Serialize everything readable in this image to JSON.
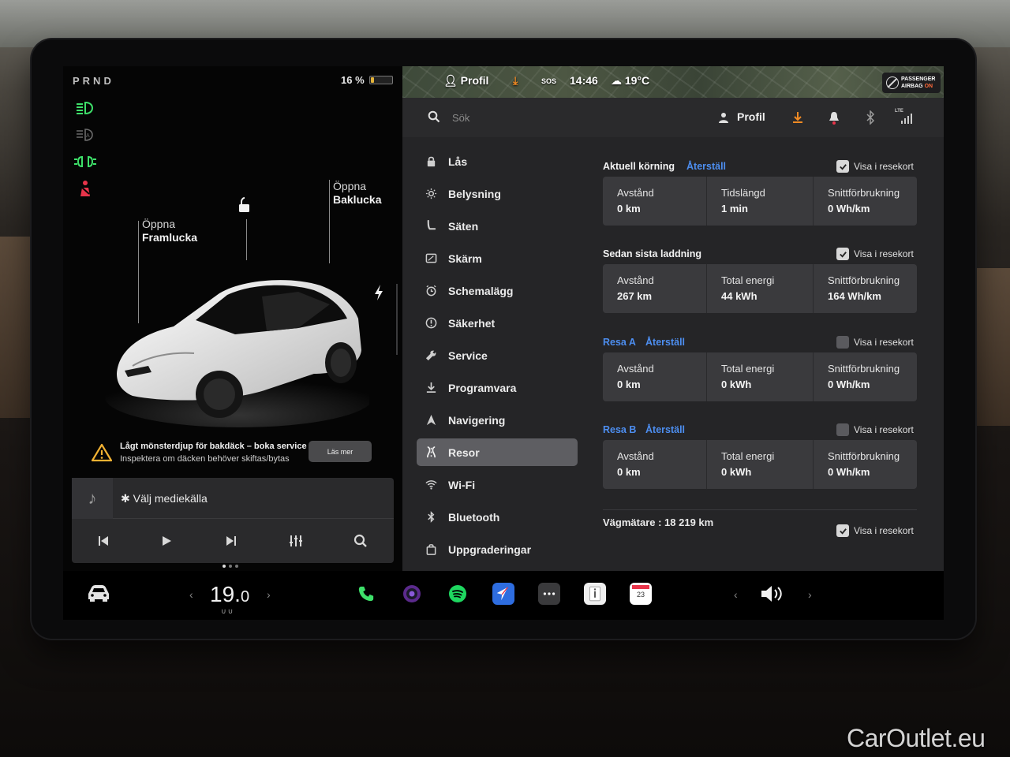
{
  "left_panel": {
    "gear": "PRND",
    "battery_text": "16 %",
    "battery_level": 0.16,
    "frunk_label": {
      "line1": "Öppna",
      "line2": "Framlucka"
    },
    "trunk_label": {
      "line1": "Öppna",
      "line2": "Baklucka"
    },
    "alert": {
      "title": "Lågt mönsterdjup för bakdäck – boka service",
      "subtitle": "Inspektera om däcken behöver skiftas/bytas",
      "button": "Läs mer"
    },
    "media": {
      "source": "✱ Välj mediekälla"
    }
  },
  "status_bar": {
    "profile": "Profil",
    "sos": "SOS",
    "time": "14:46",
    "temperature": "19°C",
    "airbag_line1": "PASSENGER",
    "airbag_line2": "AIRBAG",
    "airbag_state": "ON"
  },
  "topbar": {
    "search_placeholder": "Sök",
    "profile_label": "Profil",
    "lte": "LTE"
  },
  "nav": {
    "items": [
      {
        "label": "Lås",
        "icon": "lock-icon"
      },
      {
        "label": "Belysning",
        "icon": "sun-icon"
      },
      {
        "label": "Säten",
        "icon": "seat-icon"
      },
      {
        "label": "Skärm",
        "icon": "screen-icon"
      },
      {
        "label": "Schemalägg",
        "icon": "alarm-clock-icon"
      },
      {
        "label": "Säkerhet",
        "icon": "alert-circle-icon"
      },
      {
        "label": "Service",
        "icon": "wrench-icon"
      },
      {
        "label": "Programvara",
        "icon": "download-icon"
      },
      {
        "label": "Navigering",
        "icon": "navigation-arrow-icon"
      },
      {
        "label": "Resor",
        "icon": "trips-icon",
        "active": true
      },
      {
        "label": "Wi-Fi",
        "icon": "wifi-icon"
      },
      {
        "label": "Bluetooth",
        "icon": "bluetooth-icon"
      },
      {
        "label": "Uppgraderingar",
        "icon": "shopping-bag-icon"
      }
    ]
  },
  "trips": {
    "show_label": "Visa i resekort",
    "reset_label": "Återställ",
    "current": {
      "title": "Aktuell körning",
      "show_checked": true,
      "stats": [
        {
          "label": "Avstånd",
          "value": "0 km"
        },
        {
          "label": "Tidslängd",
          "value": "1 min"
        },
        {
          "label": "Snittförbrukning",
          "value": "0 Wh/km"
        }
      ]
    },
    "since_charge": {
      "title": "Sedan sista laddning",
      "show_checked": true,
      "stats": [
        {
          "label": "Avstånd",
          "value": "267 km"
        },
        {
          "label": "Total energi",
          "value": "44 kWh"
        },
        {
          "label": "Snittförbrukning",
          "value": "164 Wh/km"
        }
      ]
    },
    "trip_a": {
      "title": "Resa A",
      "show_checked": false,
      "stats": [
        {
          "label": "Avstånd",
          "value": "0 km"
        },
        {
          "label": "Total energi",
          "value": "0 kWh"
        },
        {
          "label": "Snittförbrukning",
          "value": "0 Wh/km"
        }
      ]
    },
    "trip_b": {
      "title": "Resa B",
      "show_checked": false,
      "stats": [
        {
          "label": "Avstånd",
          "value": "0 km"
        },
        {
          "label": "Total energi",
          "value": "0 kWh"
        },
        {
          "label": "Snittförbrukning",
          "value": "0 Wh/km"
        }
      ]
    },
    "odometer": "Vägmätare :  18 219 km",
    "odometer_checked": true
  },
  "dock": {
    "temp_main": "19.",
    "temp_decimal": "0",
    "prev": "‹",
    "next": "›",
    "calendar_day": "23",
    "seat_heaters": "∪∪"
  },
  "watermark": "CarOutlet.eu",
  "colors": {
    "accent_blue": "#4d8ef0",
    "headlight_green": "#3ee06a",
    "seatbelt_red": "#e8344a",
    "download_orange": "#f08a24",
    "alert_yellow": "#f2b233"
  }
}
